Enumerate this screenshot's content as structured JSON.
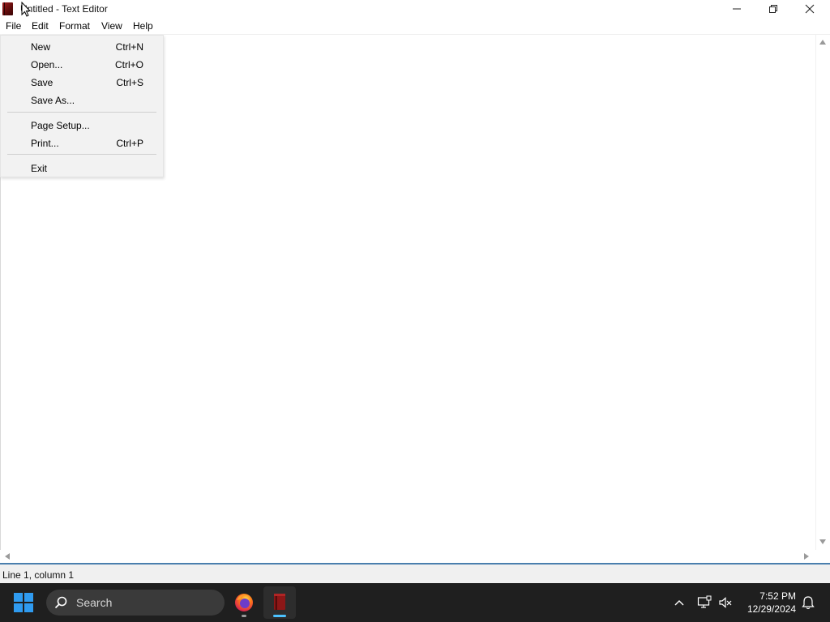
{
  "window": {
    "title": "Untitled - Text Editor",
    "accent_color": "#4a7fae"
  },
  "menubar": {
    "items": [
      {
        "label": "File"
      },
      {
        "label": "Edit"
      },
      {
        "label": "Format"
      },
      {
        "label": "View"
      },
      {
        "label": "Help"
      }
    ]
  },
  "file_menu": {
    "items": [
      {
        "label": "New",
        "shortcut": "Ctrl+N"
      },
      {
        "label": "Open...",
        "shortcut": "Ctrl+O"
      },
      {
        "label": "Save",
        "shortcut": "Ctrl+S"
      },
      {
        "label": "Save As...",
        "shortcut": ""
      },
      {
        "label": "Page Setup...",
        "shortcut": ""
      },
      {
        "label": "Print...",
        "shortcut": "Ctrl+P"
      },
      {
        "label": "Exit",
        "shortcut": ""
      }
    ]
  },
  "editor": {
    "content": ""
  },
  "statusbar": {
    "position": "Line 1, column 1"
  },
  "taskbar": {
    "search_placeholder": "Search",
    "start_color": "#2f9bf0",
    "clock_time": "7:52 PM",
    "clock_date": "12/29/2024",
    "icons": [
      "windows-start-icon",
      "search-icon",
      "firefox-icon",
      "text-editor-icon",
      "chevron-up-icon",
      "network-icon",
      "volume-muted-icon",
      "notification-bell-icon"
    ]
  }
}
